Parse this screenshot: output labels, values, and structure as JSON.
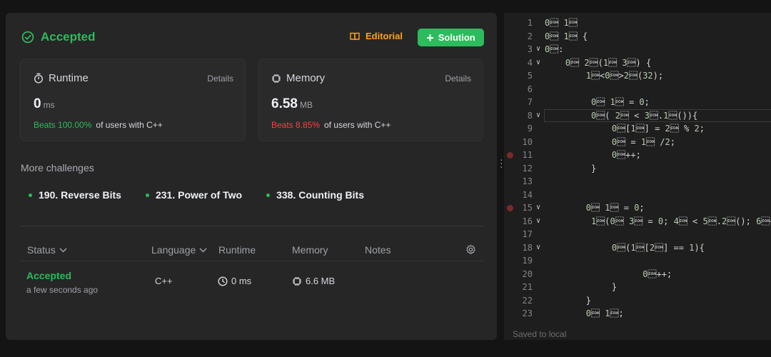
{
  "result": {
    "status": "Accepted",
    "editorial_label": "Editorial",
    "solution_label": "Solution"
  },
  "runtime": {
    "label": "Runtime",
    "details_label": "Details",
    "value": "0",
    "unit": "ms",
    "beats_value": "Beats 100.00%",
    "beats_suffix": "of users with C++"
  },
  "memory": {
    "label": "Memory",
    "details_label": "Details",
    "value": "6.58",
    "unit": "MB",
    "beats_value": "Beats 8.85%",
    "beats_suffix": "of users with C++"
  },
  "more_challenges": {
    "title": "More challenges",
    "items": [
      "190. Reverse Bits",
      "231. Power of Two",
      "338. Counting Bits"
    ]
  },
  "submissions": {
    "headers": {
      "status": "Status",
      "language": "Language",
      "runtime": "Runtime",
      "memory": "Memory",
      "notes": "Notes"
    },
    "rows": [
      {
        "status": "Accepted",
        "time": "a few seconds ago",
        "language": "C++",
        "runtime": "0 ms",
        "memory": "6.6 MB"
      }
    ]
  },
  "editor": {
    "footer": "Saved to local",
    "lines": [
      "#include <vector>",
      "class Solution {",
      "public:",
      "    int hammingWeight(uint32_t n) {",
      "        vector<int>binary(32);",
      "",
      "         int i = 0;",
      "         while( i < binary.size()){",
      "             binary[i] = n % 2;",
      "             n = n /2;",
      "             i++;",
      "         }",
      "",
      "",
      "        int countone = 0;",
      "         for(int i = 0; i < binary.size(); i++",
      "",
      "             if(binary[i] == 1){",
      "",
      "                   countone++;",
      "             }",
      "        }",
      "        return countone;"
    ]
  },
  "colors": {
    "accent_green": "#2cbb5d",
    "accent_orange": "#ffa116",
    "beats_red": "#ef4743"
  }
}
